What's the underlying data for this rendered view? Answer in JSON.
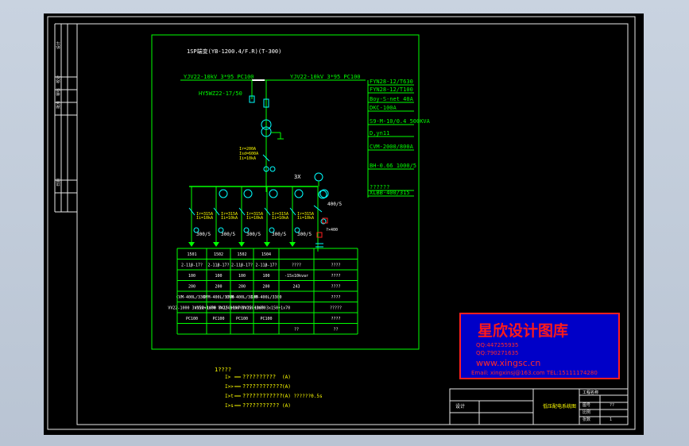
{
  "drawing": {
    "title": "1SP端变(YB-1200.4/F.R)(T-300)",
    "incoming_left": "YJV22-10kV 3*95 PC100",
    "incoming_right": "YJV22-10kV 3*95 PC100",
    "arrester": "HY5WZ22-17/50",
    "spec_list": [
      "FYN28-12/T630",
      "FYN28-12/T100",
      "Boy-S-net 40A",
      "DKC-100A",
      "S9-M-10/0.4 500KVA",
      "D,yn11",
      "CVM-2000/800A",
      "BH-0.66 1000/5",
      "??????",
      "XLBB-400/315"
    ],
    "ct_labels": [
      "Ir=200A",
      "Isd=600A",
      "Ii=10kA"
    ],
    "meter_label": "3X",
    "branch_labels": [
      "Ir=315A\nIi=10kA",
      "Ir=315A\nIi=10kA",
      "Ir=315A\nIi=10kA",
      "Ir=315A\nIi=10kA",
      "Ir=315A\nIi=10kA"
    ],
    "ct_ratio": "300/5",
    "cap_ratio": "400/5",
    "cap_note": "?×400",
    "table": {
      "rows": [
        [
          "1501",
          "1502",
          "1502",
          "1504",
          "",
          ""
        ],
        [
          "2-11β-17?",
          "2-11β-17?",
          "2-11β-17?",
          "2-11β-17?",
          "????",
          "????"
        ],
        [
          "100",
          "100",
          "100",
          "100",
          "-15x10kvar",
          "????"
        ],
        [
          "200",
          "200",
          "200",
          "200",
          "243",
          "????"
        ],
        [
          "CVM-400L/3300",
          "CVM-400L/3300",
          "CVM-400L/3300",
          "CVM-400L/3300",
          "",
          "????"
        ],
        [
          "VV22-1000 3x150+1x70",
          "VV22-1000 3x150+1x70",
          "VV22-1000 3x150+1x70",
          "VV22-1000 3x150+1x70",
          "",
          "?????"
        ],
        [
          "PC100",
          "PC100",
          "PC100",
          "PC100",
          "",
          "????"
        ],
        [
          "",
          "",
          "",
          "",
          "??",
          "??"
        ]
      ]
    },
    "legend": {
      "title": "1????",
      "items": [
        {
          "sym": "I>",
          "text": "??????????",
          "unit": "(A)"
        },
        {
          "sym": "I>>",
          "text": "????????????",
          "unit": "(A)"
        },
        {
          "sym": "I>t",
          "text": "????????????",
          "unit": "(A)  ??????0.5s"
        },
        {
          "sym": "I>s",
          "text": "???????????",
          "unit": "(A)"
        }
      ]
    }
  },
  "watermark": {
    "name": "星欣设计图库",
    "qq1": "QQ:447255935",
    "qq2": "QQ:790271635",
    "url": "www.xingsc.cn",
    "email": "Email: xingxinsj@163.com  TEL:15111174280"
  },
  "title_block": {
    "center": "低压配电系统图",
    "left_label": "设计",
    "right_top": "工程名称",
    "right_items": [
      "图号",
      "比例",
      "张数"
    ],
    "right_vals": [
      "??",
      "",
      "1"
    ]
  },
  "left_strip": [
    "设计",
    "校对",
    "审核",
    "批准",
    "日期"
  ],
  "colors": {
    "green": "#00ff00",
    "cyan": "#00ffff",
    "yellow": "#ffff00",
    "white": "#ffffff",
    "red": "#ff2020",
    "magenta": "#ff00ff"
  }
}
